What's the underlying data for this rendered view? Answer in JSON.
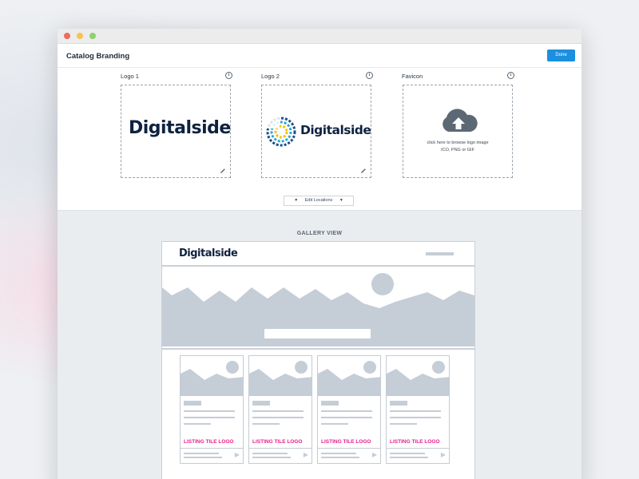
{
  "window": {
    "title": "Catalog Branding",
    "done_label": "Done"
  },
  "slots": [
    {
      "label": "Logo 1",
      "logo_text": "Digitalside"
    },
    {
      "label": "Logo 2",
      "logo_text": "Digitalside"
    },
    {
      "label": "Favicon",
      "hint_line1": "click here to browse logo image",
      "hint_line2": "ICO, PNG or GIF"
    }
  ],
  "edit_locations_label": "Edit Locations",
  "gallery": {
    "label": "GALLERY VIEW",
    "logo_text": "Digitalside",
    "tile_logo_label": "LISTING TILE LOGO"
  },
  "icons": [
    "info-icon",
    "pencil-icon",
    "cloud-upload-icon",
    "caret-down-icon",
    "play-icon"
  ],
  "colors": {
    "accent": "#1b8fe0",
    "brand_text": "#0e2240",
    "tile_logo": "#e91e8c",
    "wire": "#c5cdd6"
  }
}
